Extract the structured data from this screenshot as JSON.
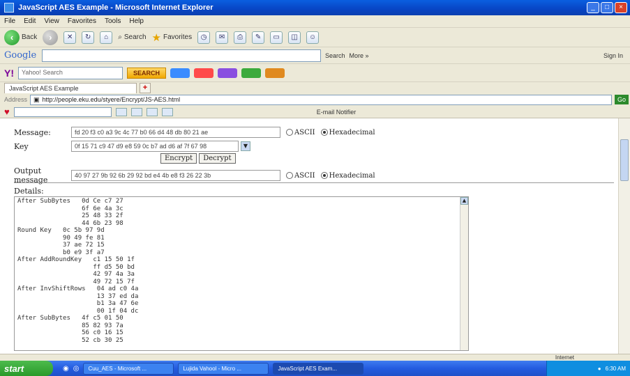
{
  "window": {
    "title": "JavaScript AES Example - Microsoft Internet Explorer"
  },
  "menu": [
    "File",
    "Edit",
    "View",
    "Favorites",
    "Tools",
    "Help"
  ],
  "toolbar": {
    "back": "Back",
    "search": "Search",
    "favorites": "Favorites"
  },
  "google_bar": {
    "logo": "Google",
    "search_label": "Search",
    "more": "More »",
    "signin": "Sign In"
  },
  "yahoo_bar": {
    "placeholder": "Yahoo! Search",
    "search_button": "SEARCH"
  },
  "tabs": [
    {
      "label": "JavaScript AES Example"
    }
  ],
  "address": {
    "label": "Address",
    "url": "http://people.eku.edu/styere/Encrypt/JS-AES.html",
    "go": "Go"
  },
  "links_bar": {
    "email_notifier": "E-mail Notifier"
  },
  "form": {
    "message_label": "Message:",
    "message_value": "fd 20 f3 c0 a3 9c 4c 77 b0 66 d4 48 db 80 21 ae",
    "key_label": "Key",
    "key_value": "0f 15 71 c9 47 d9 e8 59 0c b7 ad d6 af 7f 67 98",
    "encrypt_label": "Encrypt",
    "decrypt_label": "Decrypt",
    "output_label": "Output message",
    "output_value": "40 97 27 9b 92 6b 29 92 bd e4 4b e8 f3 26 22 3b",
    "ascii_label": "ASCII",
    "hex_label": "Hexadecimal",
    "details_label": "Details:"
  },
  "details_lines": [
    "After SubBytes   0d Ce c7 27",
    "                 6f 6e 4a 3c",
    "                 25 48 33 2f",
    "                 44 6b 23 98",
    "Round Key   0c 5b 97 9d",
    "            90 49 fe 81",
    "            37 ae 72 15",
    "            b0 e9 3f a7",
    "After AddRoundKey   c1 15 50 1f",
    "                    ff d5 50 bd",
    "                    42 97 4a 3a",
    "                    49 72 15 7f",
    "After InvShiftRows   04 ad c0 4a",
    "                     13 37 ed da",
    "                     b1 3a 47 6e",
    "                     00 1f 04 dc",
    "After SubBytes   4f c5 01 50",
    "                 85 82 93 7a",
    "                 56 c0 16 15",
    "                 52 cb 30 25"
  ],
  "status": {
    "zone": "Internet"
  },
  "taskbar": {
    "start": "start",
    "tasks": [
      "Cuu_AES - Microsoft ...",
      "Lujida Vahool - Micro ...",
      "JavaScript AES Exam..."
    ],
    "clock": "6:30 AM"
  }
}
